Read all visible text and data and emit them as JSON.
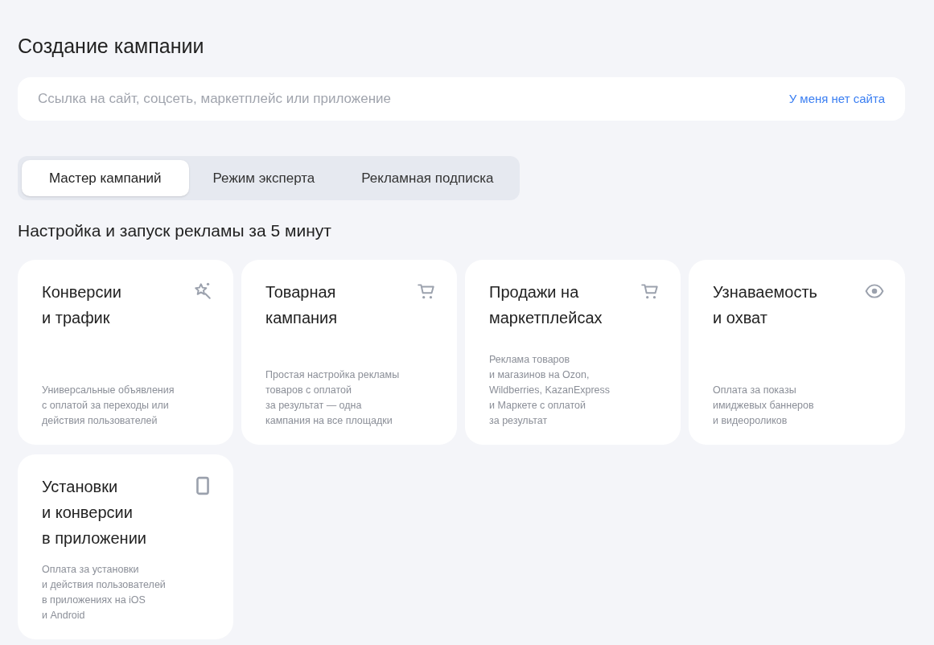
{
  "title": "Создание кампании",
  "link_field": {
    "placeholder": "Ссылка на сайт, соцсеть, маркетплейс или приложение",
    "link": "У меня нет сайта"
  },
  "tabs": [
    {
      "label": "Мастер кампаний",
      "selected": true
    },
    {
      "label": "Режим эксперта",
      "selected": false
    },
    {
      "label": "Рекламная подписка",
      "selected": false
    }
  ],
  "section_title": "Настройка и запуск рекламы за 5 минут",
  "cards": [
    {
      "kind": "sparkle",
      "title": "Конверсии\nи трафик",
      "description": "Универсальные объявления\nс оплатой за переходы или\nдействия пользователей"
    },
    {
      "kind": "cart",
      "title": "Товарная\nкампания",
      "description": "Простая настройка рекламы\nтоваров с оплатой\nза результат — одна\nкампания на все площадки"
    },
    {
      "kind": "cart",
      "title": "Продажи на\nмаркетплейсах",
      "description": "Реклама товаров\nи магазинов на Ozon,\nWildberries, KazanExpress\nи Маркете с оплатой\nза результат"
    },
    {
      "kind": "eye",
      "title": "Узнаваемость\nи охват",
      "description": "Оплата за показы\nимиджевых баннеров\nи видеороликов"
    },
    {
      "kind": "phone",
      "title": "Установки\nи конверсии\nв приложении",
      "description": "Оплата за установки\nи действия пользователей\nв приложениях на iOS\nи Android"
    }
  ]
}
